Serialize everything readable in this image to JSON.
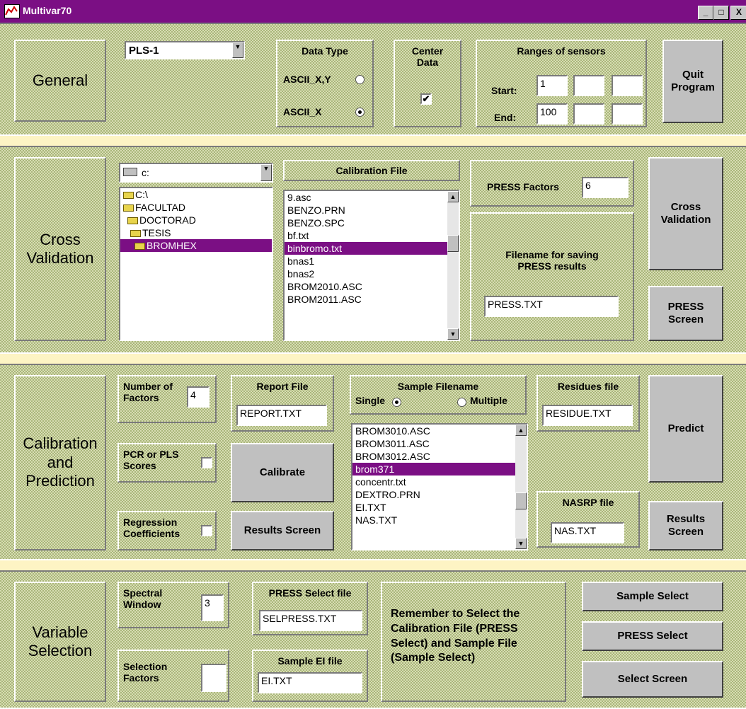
{
  "window": {
    "title": "Multivar70",
    "min": "_",
    "max": "□",
    "close": "X"
  },
  "general": {
    "section": "General",
    "method": "PLS-1",
    "data_type_title": "Data Type",
    "opt_xy": "ASCII_X,Y",
    "opt_x": "ASCII_X",
    "center_title": "Center\nData",
    "center_checked": "✔",
    "ranges_title": "Ranges of sensors",
    "start_label": "Start:",
    "end_label": "End:",
    "start_value": "1",
    "end_value": "100",
    "quit": "Quit\nProgram"
  },
  "cross": {
    "section": "Cross\nValidation",
    "drive": "c:",
    "dirs": [
      "C:\\",
      "FACULTAD",
      "DOCTORAD",
      "TESIS",
      "BROMHEX"
    ],
    "cal_title": "Calibration File",
    "cal_files": [
      "9.asc",
      "BENZO.PRN",
      "BENZO.SPC",
      "bf.txt",
      "binbromo.txt",
      "bnas1",
      "bnas2",
      "BROM2010.ASC",
      "BROM2011.ASC"
    ],
    "press_factors_label": "PRESS Factors",
    "press_factors_value": "6",
    "press_filename_label": "Filename for saving\nPRESS results",
    "press_filename_value": "PRESS.TXT",
    "cv_button": "Cross\nValidation",
    "press_screen_button": "PRESS\nScreen"
  },
  "calib": {
    "section": "Calibration\nand\nPrediction",
    "nfactors_label": "Number of\nFactors",
    "nfactors_value": "4",
    "report_title": "Report File",
    "report_value": "REPORT.TXT",
    "sample_title": "Sample Filename",
    "single": "Single",
    "multiple": "Multiple",
    "sample_files": [
      "BROM3010.ASC",
      "BROM3011.ASC",
      "BROM3012.ASC",
      "brom371",
      "concentr.txt",
      "DEXTRO.PRN",
      "EI.TXT",
      "NAS.TXT"
    ],
    "residues_title": "Residues file",
    "residues_value": "RESIDUE.TXT",
    "predict_button": "Predict",
    "pcr_label": "PCR or PLS\nScores",
    "calibrate_button": "Calibrate",
    "nasrp_title": "NASRP file",
    "nasrp_value": "NAS.TXT",
    "regression_label": "Regression\nCoefficients",
    "results_screen_button": "Results Screen",
    "results_screen2_button": "Results\nScreen"
  },
  "varsel": {
    "section": "Variable\nSelection",
    "spectral_label": "Spectral\nWindow",
    "spectral_value": "3",
    "press_select_title": "PRESS Select file",
    "press_select_value": "SELPRESS.TXT",
    "remember_text": "Remember to Select the\nCalibration File (PRESS\nSelect) and Sample File\n(Sample Select)",
    "sample_select_button": "Sample Select",
    "press_select_button": "PRESS Select",
    "select_screen_button": "Select Screen",
    "selection_factors_label": "Selection\nFactors",
    "selection_factors_value": "",
    "sample_ei_title": "Sample EI file",
    "sample_ei_value": "EI.TXT"
  },
  "colors": {
    "title_bar": "#7b0f84",
    "selection": "#7b0f84",
    "background": "#fdf4c4",
    "panel": "#c6cf9c"
  }
}
